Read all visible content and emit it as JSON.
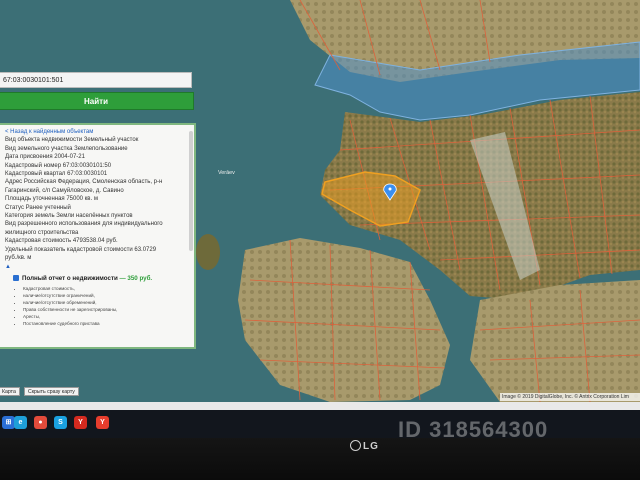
{
  "search": {
    "value": "67:03:0030101:501",
    "button_label": "Найти"
  },
  "info": {
    "back_link": "< Назад к найденным объектам",
    "rows": [
      "Вид объекта недвижимости Земельный участок",
      "Вид земельного участка Землепользование",
      "Дата присвоения 2004-07-21",
      "Кадастровый номер 67:03:0030101:50",
      "Кадастровый квартал 67:03:0030101",
      "Адрес Российская Федерация, Смоленская область, р-н",
      "Гагаринский, с/п Самуйловское, д. Савино",
      "Площадь уточненная 75000 кв. м",
      "Статус Ранее учтенный",
      "Категория земель Земли населённых пунктов",
      "Вид разрешенного использования для индивидуального",
      "жилищного строительства",
      "Кадастровая стоимость 4793538.04 руб.",
      "Удельный показатель кадастровой стоимости 63.0729",
      "руб./кв. м"
    ],
    "arrow": "▲"
  },
  "report": {
    "title": "Полный отчет о недвижимости",
    "price": "— 350 руб.",
    "items": [
      "Кадастровая стоимость,",
      "наличие/отсутствие ограничений,",
      "наличие/отсутствие обременений,",
      "Права собственности не зарегистрированы,",
      "Аресты,",
      "Постановление судебного пристава"
    ]
  },
  "map": {
    "village_label": "Verāev",
    "copyright": "Image © 2019 DigitalGlobe, Inc. © Antrix Corporation Lim",
    "buttons": {
      "left": "Карта",
      "show": "Скрыть сразу карту"
    }
  },
  "monitor": {
    "brand": "LG",
    "watermark": "ID 318564300"
  },
  "taskbar": {
    "icons": [
      {
        "name": "windows-start-icon",
        "glyph": "⊞",
        "color": "#2b6fd6"
      },
      {
        "name": "edge-icon",
        "glyph": "e",
        "color": "#1e9fd8"
      },
      {
        "name": "chrome-icon",
        "glyph": "●",
        "color": "#e24b3b"
      },
      {
        "name": "skype-icon",
        "glyph": "S",
        "color": "#1aa1e0"
      },
      {
        "name": "yandex-icon",
        "glyph": "Y",
        "color": "#d42a1f"
      },
      {
        "name": "yandex-browser-icon",
        "glyph": "Y",
        "color": "#e63d2d"
      }
    ]
  },
  "colors": {
    "accent": "#2e9e3a",
    "parcel_highlight": "#f0a020",
    "parcel_lines": "#e0603a",
    "water": "#3c6f76"
  }
}
